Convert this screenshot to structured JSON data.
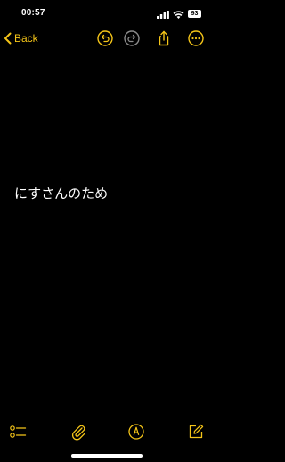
{
  "status_bar": {
    "time": "00:57",
    "battery": "93"
  },
  "nav": {
    "back_label": "Back",
    "icons": [
      "undo-icon",
      "redo-icon",
      "share-icon",
      "more-icon"
    ]
  },
  "note": {
    "text": "にすさんのため"
  },
  "toolbar": {
    "icons": [
      "checklist-icon",
      "attachment-icon",
      "markup-pen-icon",
      "compose-icon"
    ]
  },
  "colors": {
    "accent": "#f5c518",
    "background": "#000000",
    "text": "#ffffff",
    "disabled": "#8a8a8a"
  }
}
